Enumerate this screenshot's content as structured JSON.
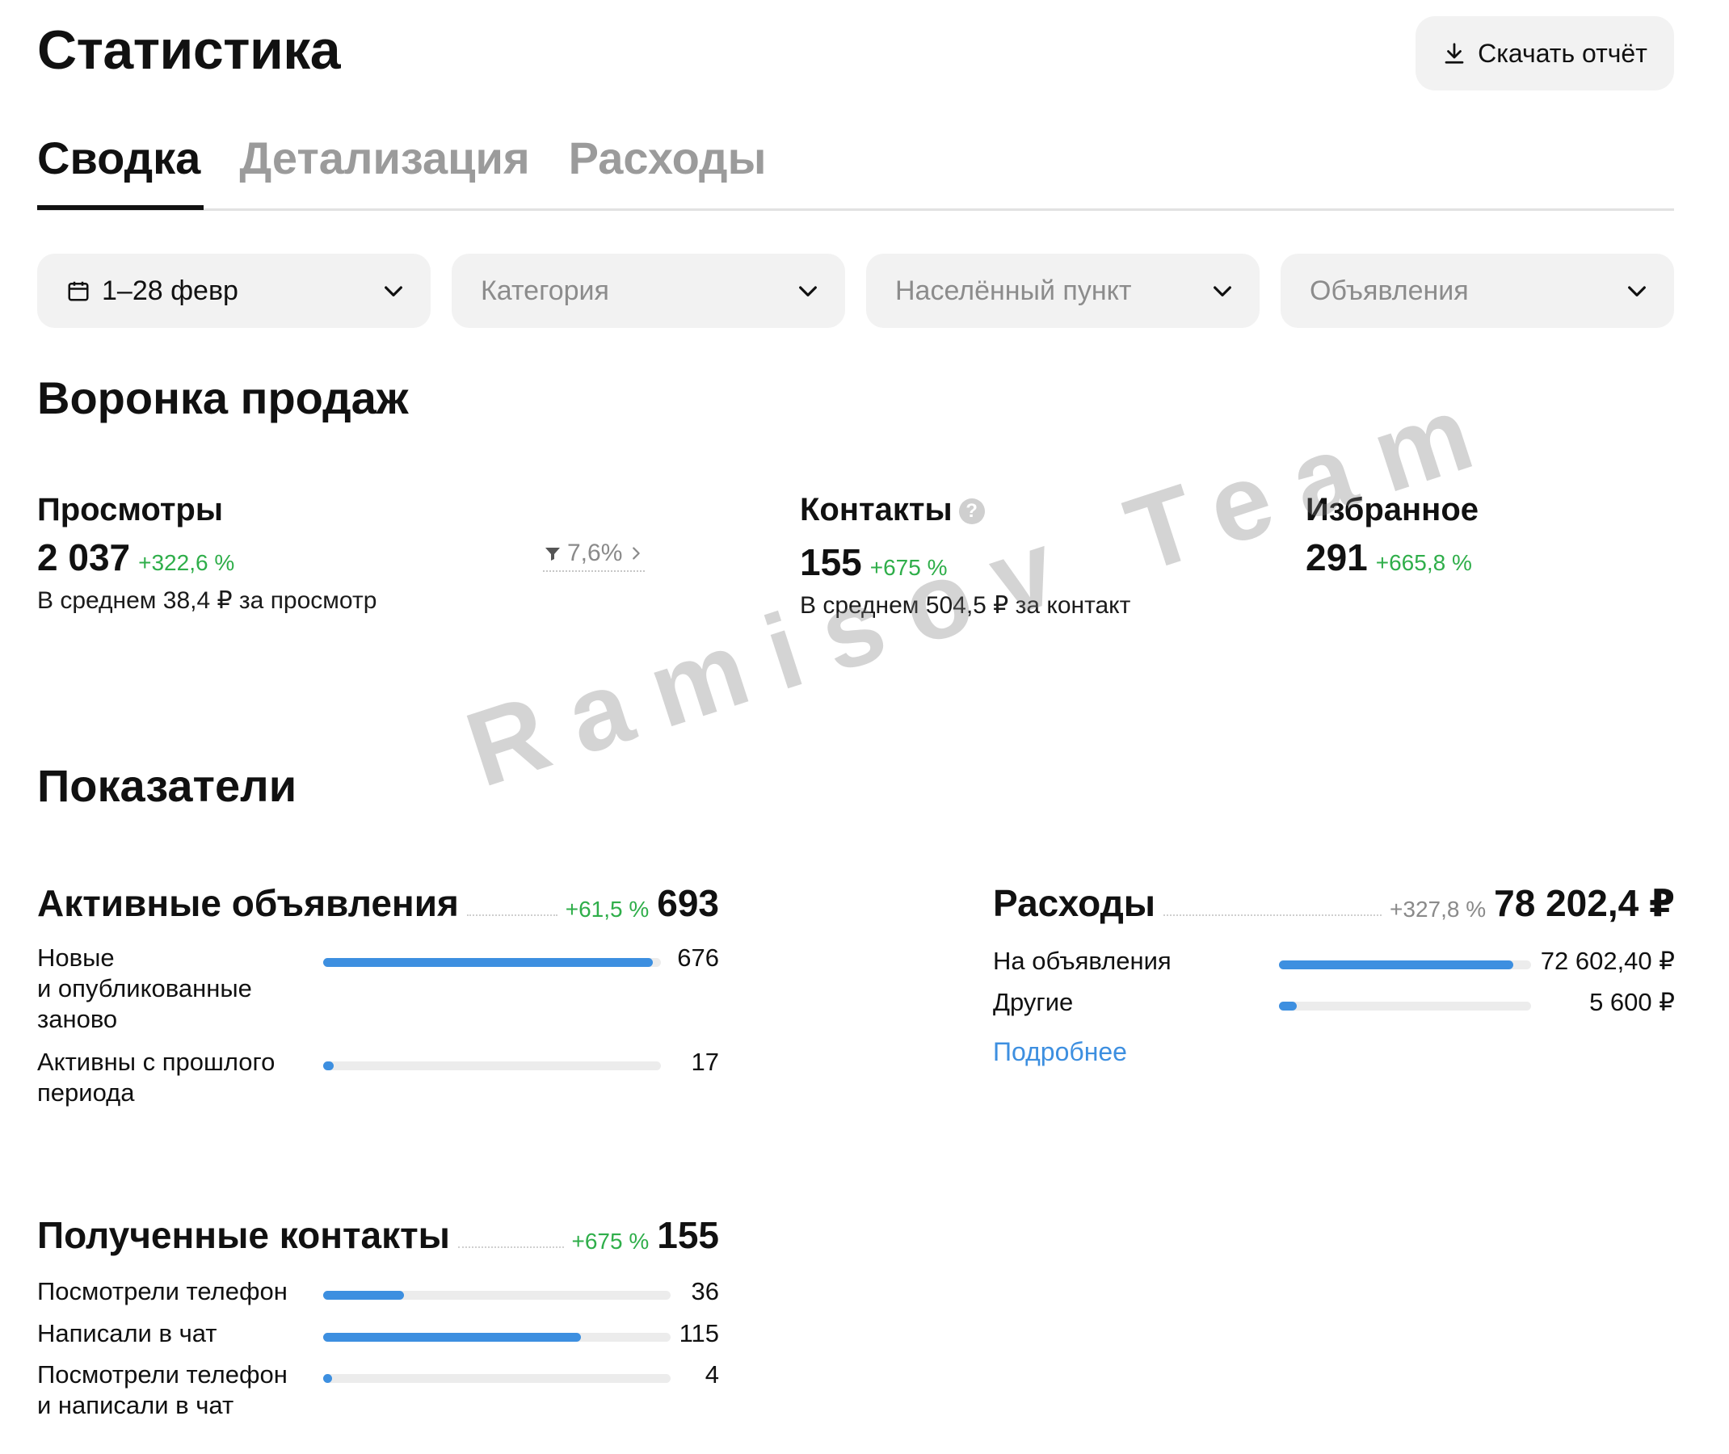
{
  "header": {
    "title": "Статистика",
    "download_label": "Скачать отчёт"
  },
  "tabs": [
    {
      "label": "Сводка",
      "active": true
    },
    {
      "label": "Детализация",
      "active": false
    },
    {
      "label": "Расходы",
      "active": false
    }
  ],
  "filters": [
    {
      "label": "1–28 февр",
      "icon": "calendar-icon"
    },
    {
      "label": "Категория"
    },
    {
      "label": "Населённый пункт"
    },
    {
      "label": "Объявления"
    }
  ],
  "funnel": {
    "title": "Воронка продаж",
    "views": {
      "label": "Просмотры",
      "value": "2 037",
      "delta": "+322,6 %",
      "sub": "В среднем 38,4 ₽ за просмотр",
      "conversion": "7,6%"
    },
    "contacts": {
      "label": "Контакты",
      "value": "155",
      "delta": "+675 %",
      "sub": "В среднем 504,5 ₽ за контакт"
    },
    "favorites": {
      "label": "Избранное",
      "value": "291",
      "delta": "+665,8 %"
    }
  },
  "indicators": {
    "title": "Показатели",
    "active_ads": {
      "name": "Активные объявления",
      "delta": "+61,5 %",
      "total": "693",
      "rows": [
        {
          "label_lines": [
            "Новые",
            "и опубликованные",
            "заново"
          ],
          "value": "676",
          "fraction": 0.975
        },
        {
          "label_lines": [
            "Активны с прошлого",
            "периода"
          ],
          "value": "17",
          "fraction": 0.03
        }
      ]
    },
    "expenses": {
      "name": "Расходы",
      "delta": "+327,8 %",
      "total": "78 202,4 ₽",
      "rows": [
        {
          "label": "На объявления",
          "value": "72 602,40 ₽",
          "fraction": 0.93
        },
        {
          "label": "Другие",
          "value": "5 600 ₽",
          "fraction": 0.07
        }
      ],
      "more": "Подробнее"
    },
    "contacts_received": {
      "name": "Полученные контакты",
      "delta": "+675 %",
      "total": "155",
      "rows": [
        {
          "label_lines": [
            "Посмотрели телефон"
          ],
          "value": "36",
          "fraction": 0.232
        },
        {
          "label_lines": [
            "Написали в чат"
          ],
          "value": "115",
          "fraction": 0.742
        },
        {
          "label_lines": [
            "Посмотрели телефон",
            "и написали в чат"
          ],
          "value": "4",
          "fraction": 0.026
        }
      ]
    }
  },
  "watermark": "Ramisov Team",
  "colors": {
    "accent": "#3d8fe0",
    "positive": "#2fae4a",
    "muted": "#8a8a8a",
    "chip_bg": "#f2f2f2"
  }
}
